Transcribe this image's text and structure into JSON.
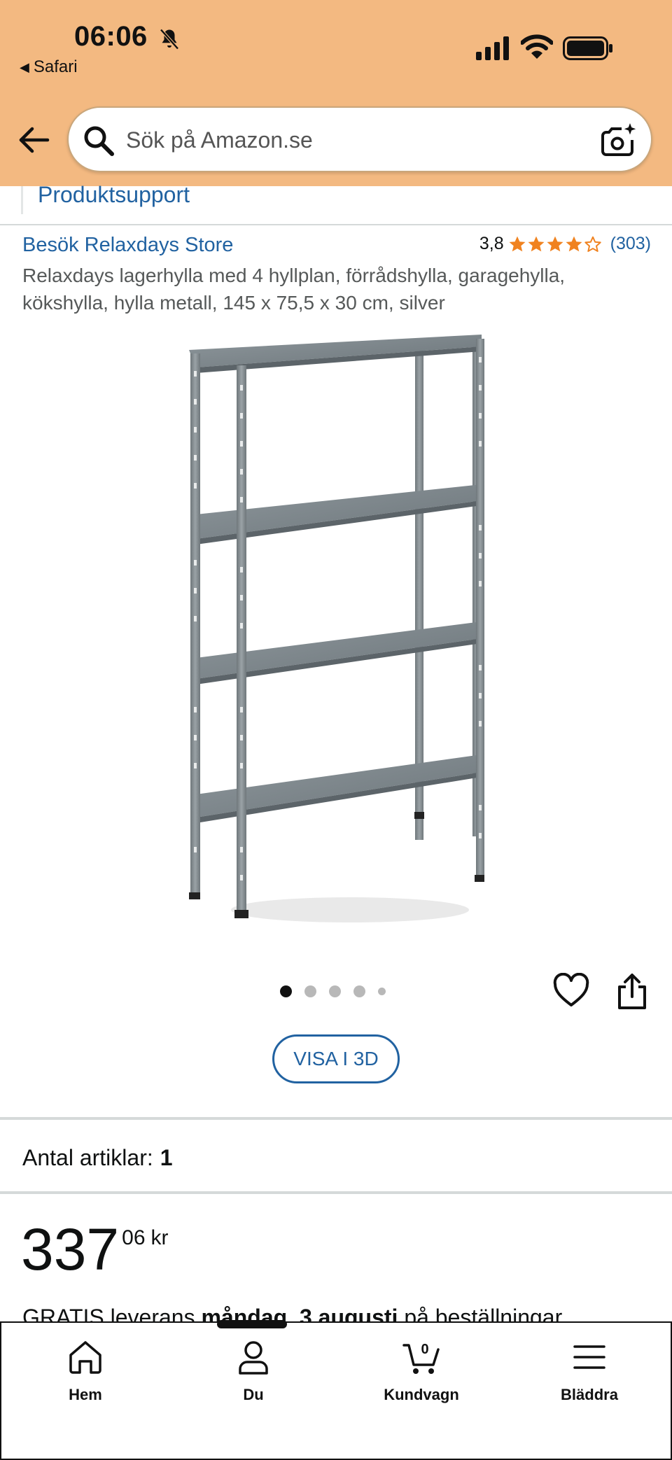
{
  "status_bar": {
    "time": "06:06",
    "back_app": "Safari"
  },
  "search": {
    "placeholder": "Sök på Amazon.se"
  },
  "support_link": "Produktsupport",
  "product": {
    "store_link": "Besök Relaxdays Store",
    "rating_value": "3,8",
    "rating_stars": 3.8,
    "review_count": "(303)",
    "title": "Relaxdays lagerhylla med 4 hyllplan, förrådshylla, garagehylla, kökshylla, hylla metall, 145 x 75,5 x 30 cm, silver",
    "image_count": 5,
    "active_image": 1
  },
  "view_3d_label": "VISA I 3D",
  "quantity": {
    "label": "Antal artiklar:",
    "value": "1"
  },
  "price": {
    "whole": "337",
    "fraction": "06",
    "currency": "kr"
  },
  "delivery": {
    "prefix": "GRATIS leverans ",
    "date": "måndag, 3 augusti",
    "suffix": " på beställningar"
  },
  "bottom_nav": {
    "home": "Hem",
    "you": "Du",
    "cart": "Kundvagn",
    "cart_count": "0",
    "browse": "Bläddra"
  },
  "colors": {
    "header_bg": "#f3b981",
    "link": "#2162a1",
    "star": "#f0821f"
  }
}
